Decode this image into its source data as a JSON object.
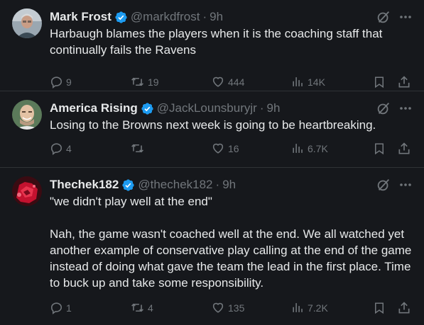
{
  "tweets": [
    {
      "name": "Mark Frost",
      "handle": "@markdfrost",
      "dot": "·",
      "time": "9h",
      "text": "Harbaugh blames the players when it is the coaching staff that continually fails the Ravens",
      "replies": "9",
      "retweets": "19",
      "likes": "444",
      "views": "14K"
    },
    {
      "name": "America Rising",
      "handle": "@JackLounsburyjr",
      "dot": "·",
      "time": "9h",
      "text": "Losing to the Browns next week is going to be heartbreaking.",
      "replies": "4",
      "retweets": "",
      "likes": "16",
      "views": "6.7K"
    },
    {
      "name": "Thechek182",
      "handle": "@thechek182",
      "dot": "·",
      "time": "9h",
      "text": "\"we didn't play well at the end\"\n\nNah, the game wasn't coached well at the end. We all watched yet another example of conservative play calling at the end of the game instead of doing what gave the team the lead in the first place. Time to buck up and take some responsibility.",
      "replies": "1",
      "retweets": "4",
      "likes": "135",
      "views": "7.2K"
    }
  ],
  "colors": {
    "background": "#16181c",
    "text": "#e7e9ea",
    "muted": "#71767b",
    "verified": "#1d9bf0",
    "divider": "#2f3336"
  },
  "icons": {
    "verified": "verified-badge-icon",
    "grok": "grok-icon",
    "more": "more-icon",
    "reply": "reply-icon",
    "retweet": "retweet-icon",
    "like": "like-icon",
    "views": "views-icon",
    "bookmark": "bookmark-icon",
    "share": "share-icon"
  }
}
